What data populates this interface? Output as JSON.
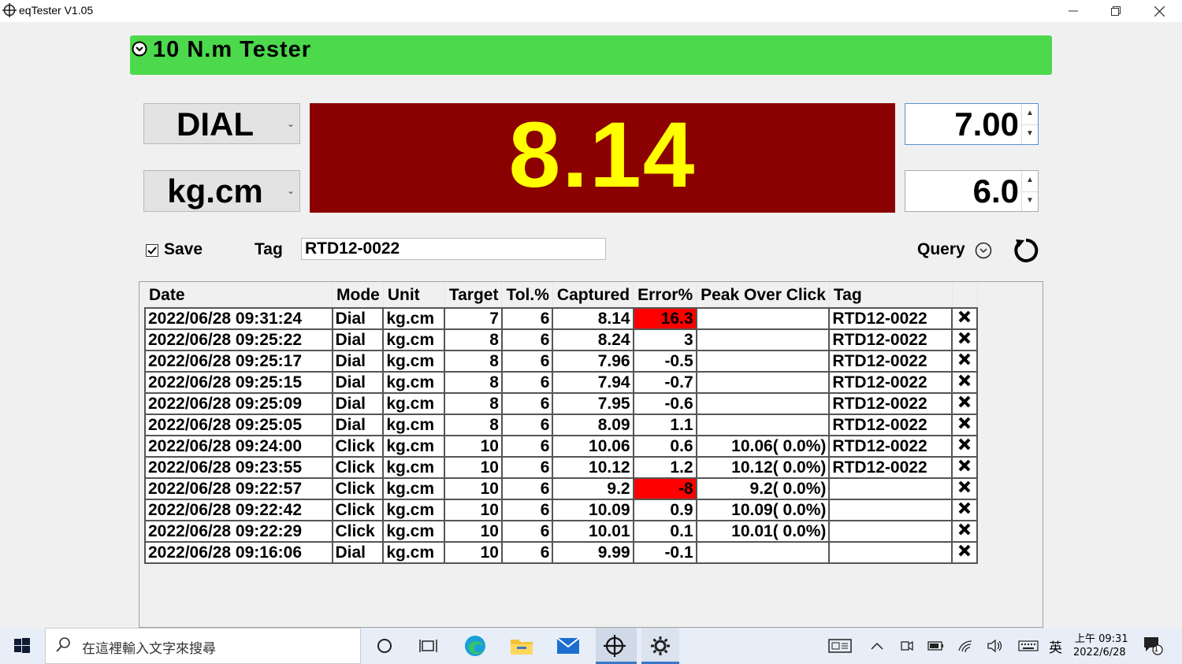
{
  "window": {
    "title": "eqTester V1.05"
  },
  "header": {
    "title": "10 N.m Tester"
  },
  "mode_select": {
    "value": "DIAL"
  },
  "unit_select": {
    "value": "kg.cm"
  },
  "reading": {
    "value": "8.14"
  },
  "target_spinner": {
    "value": "7.00"
  },
  "tolerance_spinner": {
    "value": "6.0"
  },
  "controls": {
    "save_label": "Save",
    "save_checked": true,
    "tag_label": "Tag",
    "tag_value": "RTD12-0022",
    "query_label": "Query"
  },
  "table": {
    "columns": [
      "Date",
      "Mode",
      "Unit",
      "Target",
      "Tol.%",
      "Captured",
      "Error%",
      "Peak Over Click",
      "Tag"
    ],
    "rows": [
      [
        "2022/06/28 09:31:24",
        "Dial",
        "kg.cm",
        "7",
        "6",
        "8.14",
        "16.3",
        "",
        "RTD12-0022"
      ],
      [
        "2022/06/28 09:25:22",
        "Dial",
        "kg.cm",
        "8",
        "6",
        "8.24",
        "3",
        "",
        "RTD12-0022"
      ],
      [
        "2022/06/28 09:25:17",
        "Dial",
        "kg.cm",
        "8",
        "6",
        "7.96",
        "-0.5",
        "",
        "RTD12-0022"
      ],
      [
        "2022/06/28 09:25:15",
        "Dial",
        "kg.cm",
        "8",
        "6",
        "7.94",
        "-0.7",
        "",
        "RTD12-0022"
      ],
      [
        "2022/06/28 09:25:09",
        "Dial",
        "kg.cm",
        "8",
        "6",
        "7.95",
        "-0.6",
        "",
        "RTD12-0022"
      ],
      [
        "2022/06/28 09:25:05",
        "Dial",
        "kg.cm",
        "8",
        "6",
        "8.09",
        "1.1",
        "",
        "RTD12-0022"
      ],
      [
        "2022/06/28 09:24:00",
        "Click",
        "kg.cm",
        "10",
        "6",
        "10.06",
        "0.6",
        "10.06( 0.0%)",
        "RTD12-0022"
      ],
      [
        "2022/06/28 09:23:55",
        "Click",
        "kg.cm",
        "10",
        "6",
        "10.12",
        "1.2",
        "10.12( 0.0%)",
        "RTD12-0022"
      ],
      [
        "2022/06/28 09:22:57",
        "Click",
        "kg.cm",
        "10",
        "6",
        "9.2",
        "-8",
        "9.2( 0.0%)",
        ""
      ],
      [
        "2022/06/28 09:22:42",
        "Click",
        "kg.cm",
        "10",
        "6",
        "10.09",
        "0.9",
        "10.09( 0.0%)",
        ""
      ],
      [
        "2022/06/28 09:22:29",
        "Click",
        "kg.cm",
        "10",
        "6",
        "10.01",
        "0.1",
        "10.01( 0.0%)",
        ""
      ],
      [
        "2022/06/28 09:16:06",
        "Dial",
        "kg.cm",
        "10",
        "6",
        "9.99",
        "-0.1",
        "",
        ""
      ]
    ],
    "highlight_rows": [
      0,
      8
    ],
    "highlight_color": "#ff0000"
  },
  "colors": {
    "header_bar": "#4cd94c",
    "reading_bg": "#8b0000",
    "reading_fg": "#ffff00"
  },
  "taskbar": {
    "search_placeholder": "在這裡輸入文字來搜尋",
    "ime": "英",
    "time": "上午 09:31",
    "date": "2022/6/28",
    "notification_count": "1",
    "icons": [
      "windows-start-icon",
      "search-icon",
      "cortana-icon",
      "task-view-icon",
      "edge-icon",
      "file-explorer-icon",
      "mail-icon",
      "eqtester-icon",
      "settings-icon",
      "onscreen-keyboard-icon",
      "chevron-up-icon",
      "meet-now-icon",
      "battery-icon",
      "wifi-icon",
      "volume-icon",
      "keyboard-icon",
      "notification-icon"
    ]
  }
}
